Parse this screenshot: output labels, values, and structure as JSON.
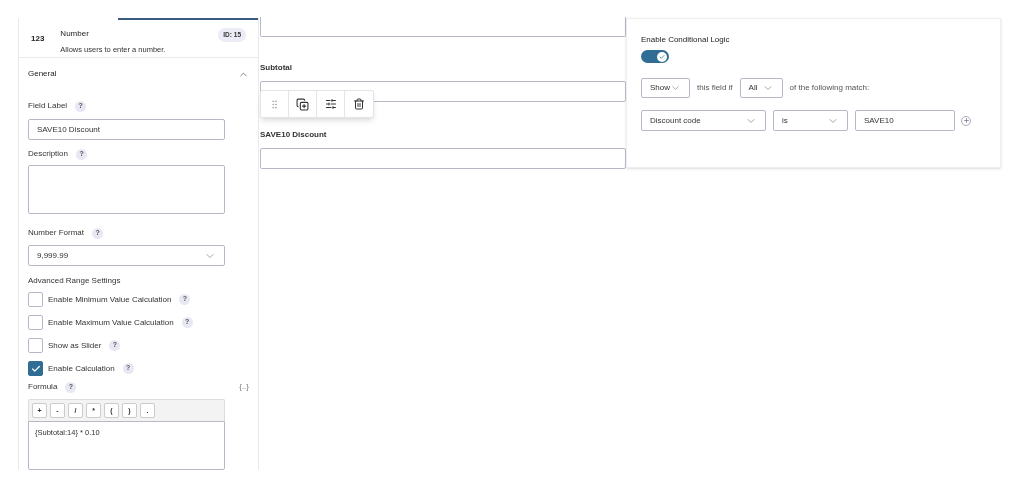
{
  "field_header": {
    "icon": "123",
    "title": "Number",
    "description": "Allows users to enter a number.",
    "id_badge": "ID: 15"
  },
  "section": {
    "title": "General"
  },
  "field_label": {
    "label": "Field Label",
    "help": "?",
    "value": "SAVE10 Discount"
  },
  "description": {
    "label": "Description",
    "help": "?"
  },
  "number_format": {
    "label": "Number Format",
    "help": "?",
    "value": "9,999.99"
  },
  "advanced_range": {
    "title": "Advanced Range Settings"
  },
  "options": [
    {
      "label": "Enable Minimum Value Calculation",
      "help": "?",
      "checked": false
    },
    {
      "label": "Enable Maximum Value Calculation",
      "help": "?",
      "checked": false
    },
    {
      "label": "Show as Slider",
      "help": "?",
      "checked": false
    },
    {
      "label": "Enable Calculation",
      "help": "?",
      "checked": true
    }
  ],
  "formula": {
    "label": "Formula",
    "help": "?",
    "merge_tag": "{..}",
    "operators": [
      "+",
      "-",
      "/",
      "*",
      "(",
      ")",
      "."
    ],
    "value": "{Subtotal:14} * 0.10"
  },
  "form_fields": [
    {
      "label": "Subtotal",
      "toolbar": true
    },
    {
      "label": "SAVE10 Discount",
      "toolbar": false
    }
  ],
  "conditional_logic": {
    "label": "Enable Conditional Logic",
    "on": true,
    "action": "Show",
    "middle_text": "this field if",
    "match": "All",
    "end_text": "of the following match:",
    "rule": {
      "field": "Discount code",
      "operator": "is",
      "value": "SAVE10"
    }
  }
}
